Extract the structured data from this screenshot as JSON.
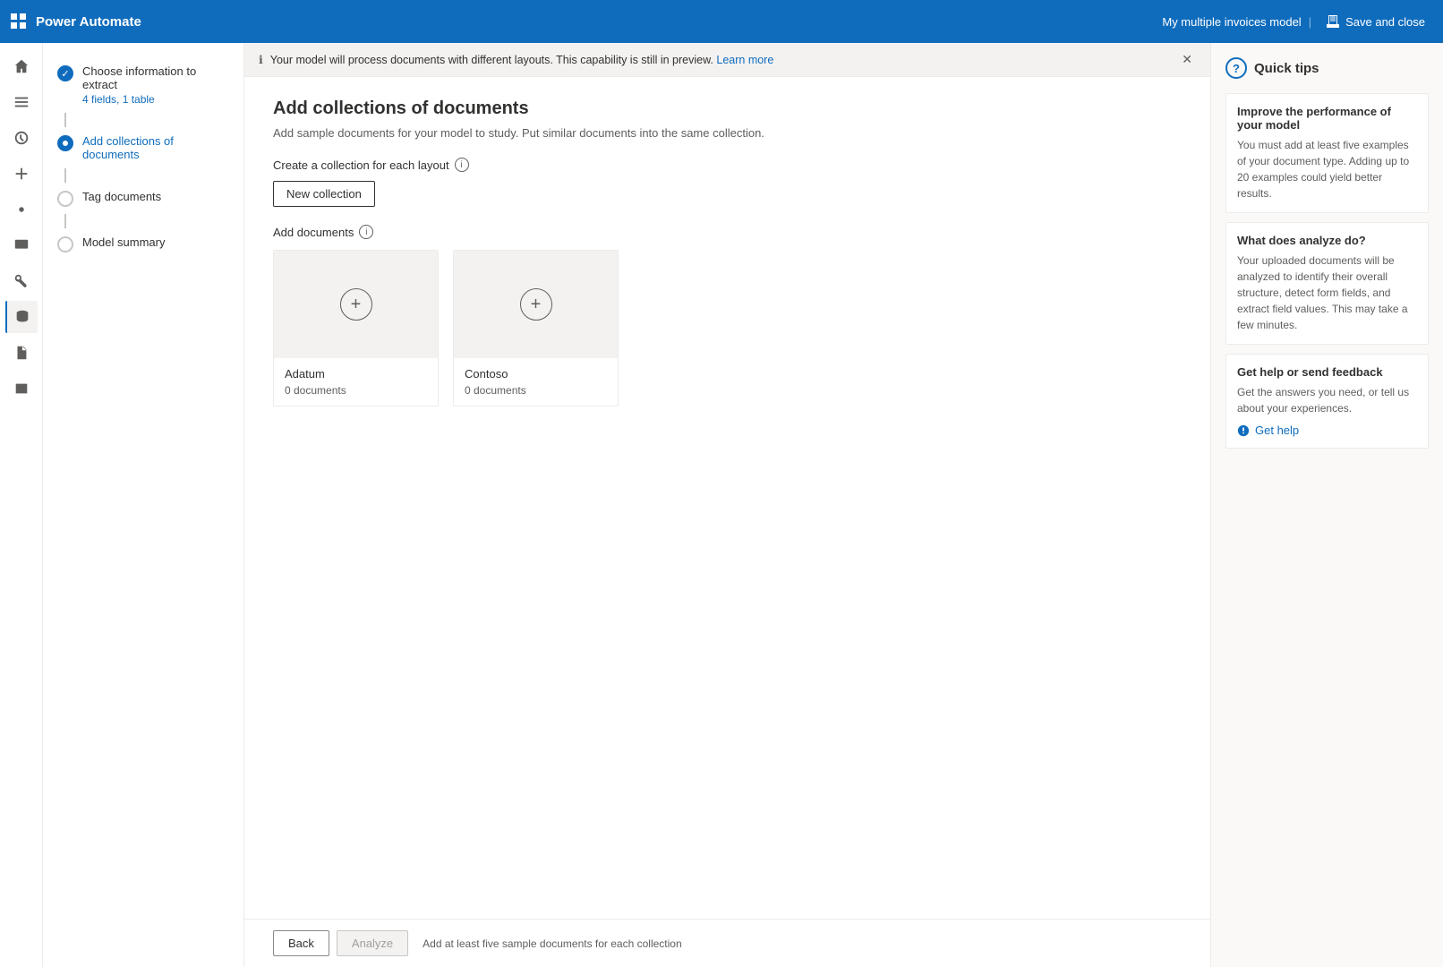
{
  "topbar": {
    "app_name": "Power Automate",
    "model_name": "My multiple invoices model",
    "save_close_label": "Save and close"
  },
  "sidebar": {
    "steps": [
      {
        "id": "choose-info",
        "title": "Choose information to extract",
        "subtitle": "4 fields, 1 table",
        "status": "completed"
      },
      {
        "id": "add-collections",
        "title": "Add collections of documents",
        "subtitle": "",
        "status": "active"
      },
      {
        "id": "tag-docs",
        "title": "Tag documents",
        "subtitle": "",
        "status": "inactive"
      },
      {
        "id": "model-summary",
        "title": "Model summary",
        "subtitle": "",
        "status": "inactive"
      }
    ]
  },
  "banner": {
    "text": "Your model will process documents with different layouts. This capability is still in preview.",
    "learn_more": "Learn more"
  },
  "main": {
    "title": "Add collections of documents",
    "description": "Add sample documents for your model to study. Put similar documents into the same collection.",
    "create_collection_label": "Create a collection for each layout",
    "new_collection_btn": "New collection",
    "add_documents_label": "Add documents",
    "collections": [
      {
        "name": "Adatum",
        "count": "0 documents"
      },
      {
        "name": "Contoso",
        "count": "0 documents"
      }
    ]
  },
  "footer": {
    "back_label": "Back",
    "analyze_label": "Analyze",
    "hint": "Add at least five sample documents for each collection"
  },
  "quick_tips": {
    "title": "Quick tips",
    "tips": [
      {
        "title": "Improve the performance of your model",
        "text": "You must add at least five examples of your document type. Adding up to 20 examples could yield better results."
      },
      {
        "title": "What does analyze do?",
        "text": "Your uploaded documents will be analyzed to identify their overall structure, detect form fields, and extract field values. This may take a few minutes."
      },
      {
        "title": "Get help or send feedback",
        "text": "Get the answers you need, or tell us about your experiences."
      }
    ],
    "get_help_label": "Get help"
  }
}
